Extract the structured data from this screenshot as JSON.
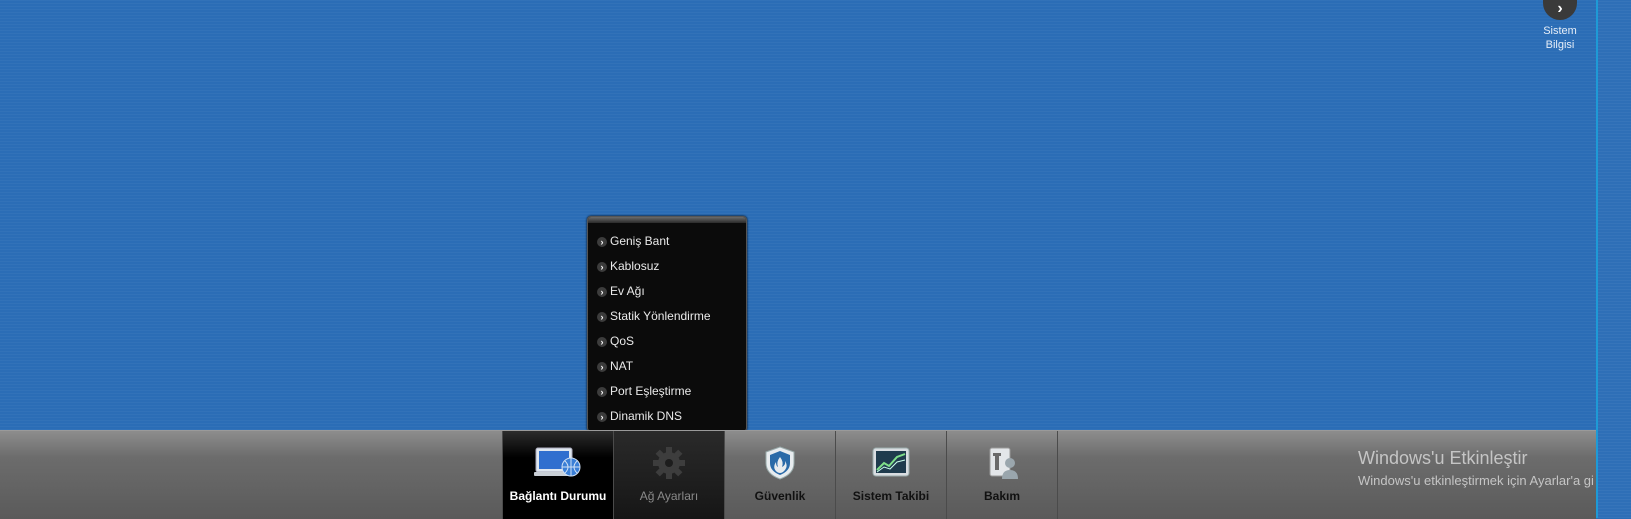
{
  "system_info": {
    "icon": "chevron-right-icon",
    "label_line1": "Sistem",
    "label_line2": "Bilgisi"
  },
  "menu": {
    "items": [
      {
        "label": "Geniş Bant"
      },
      {
        "label": "Kablosuz"
      },
      {
        "label": "Ev Ağı"
      },
      {
        "label": "Statik Yönlendirme"
      },
      {
        "label": "QoS"
      },
      {
        "label": "NAT"
      },
      {
        "label": "Port Eşleştirme"
      },
      {
        "label": "Dinamik DNS"
      }
    ]
  },
  "taskbar": {
    "tabs": [
      {
        "label": "Bağlantı Durumu",
        "icon": "monitor-globe-icon",
        "state": "active"
      },
      {
        "label": "Ağ Ayarları",
        "icon": "gear-icon",
        "state": "open"
      },
      {
        "label": "Güvenlik",
        "icon": "shield-icon",
        "state": "normal"
      },
      {
        "label": "Sistem Takibi",
        "icon": "chart-monitor-icon",
        "state": "normal"
      },
      {
        "label": "Bakım",
        "icon": "maintenance-icon",
        "state": "normal"
      }
    ]
  },
  "watermark": {
    "title": "Windows'u Etkinleştir",
    "subtitle": "Windows'u etkinleştirmek için Ayarlar'a gi"
  }
}
